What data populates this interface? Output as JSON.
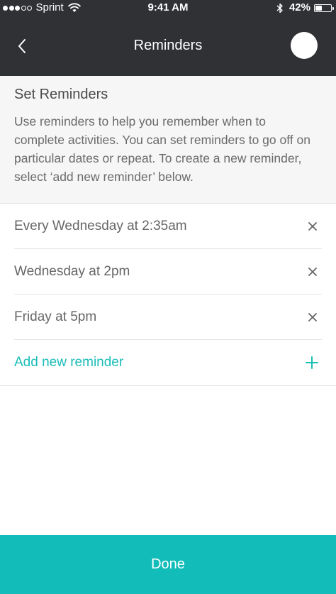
{
  "status_bar": {
    "carrier": "Sprint",
    "signal_filled": 3,
    "signal_total": 5,
    "time": "9:41 AM",
    "battery_percent": "42%",
    "battery_level": 0.42,
    "wifi_icon": "wifi-icon",
    "bluetooth_icon": "bluetooth-icon"
  },
  "nav": {
    "title": "Reminders",
    "back_icon": "chevron-left-icon",
    "avatar": "avatar"
  },
  "intro": {
    "title": "Set Reminders",
    "description": "Use reminders to help you remember when to complete activities. You can set reminders to go off on particular dates or repeat. To create a new reminder, select ‘add new reminder’ below."
  },
  "reminders": [
    {
      "label": "Every Wednesday at 2:35am"
    },
    {
      "label": "Wednesday at 2pm"
    },
    {
      "label": "Friday at 5pm"
    }
  ],
  "add_reminder": {
    "label": "Add new reminder",
    "icon": "plus-icon"
  },
  "done_button": {
    "label": "Done"
  },
  "colors": {
    "header_bg": "#2f3135",
    "accent": "#1abdb8",
    "done_bg": "#12bdb9",
    "intro_bg": "#f6f6f7"
  }
}
